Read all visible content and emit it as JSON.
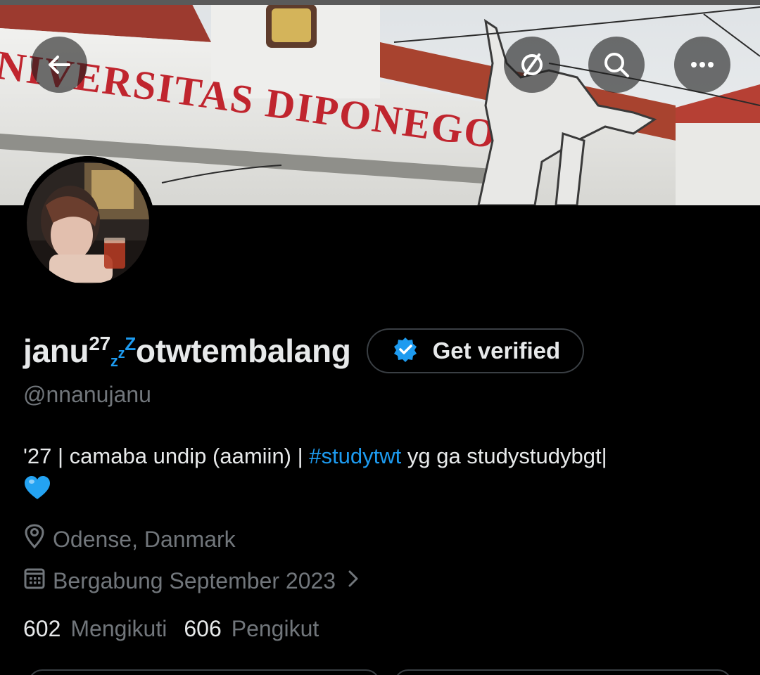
{
  "header": {
    "back_icon": "arrow-left-icon",
    "actions": [
      {
        "name": "no-notifications-icon"
      },
      {
        "name": "search-icon"
      },
      {
        "name": "more-icon"
      }
    ]
  },
  "banner": {
    "sign_text": "NIVERSITAS DIPONEGO"
  },
  "profile": {
    "name_main": "janu",
    "name_sup": "27",
    "name_sub": "z",
    "name_mid_sup": "z",
    "name_end_sup": "Z",
    "name_rest": "otwtembalang",
    "get_verified_label": "Get verified",
    "handle": "@nnanujanu",
    "bio_prefix": "'27 | camaba undip (aamiin) | ",
    "bio_hashtag": "#studytwt",
    "bio_suffix": " yg ga studystudybgt|",
    "bio_emoji": "blue-heart",
    "location": "Odense, Danmark",
    "joined": "Bergabung September 2023",
    "following_count": "602",
    "following_label": "Mengikuti",
    "followers_count": "606",
    "followers_label": "Pengikut"
  },
  "colors": {
    "background": "#000000",
    "text_primary": "#e7e9ea",
    "text_secondary": "#71767b",
    "accent": "#1d9bf0",
    "sign_red": "#c0252e"
  }
}
